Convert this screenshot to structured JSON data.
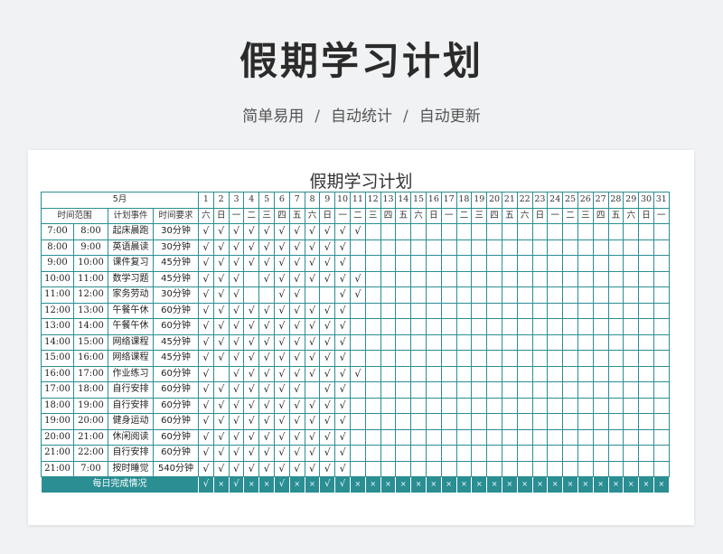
{
  "page": {
    "title": "假期学习计划",
    "subtitle_parts": [
      "简单易用",
      "自动统计",
      "自动更新"
    ],
    "separator": "/"
  },
  "sheet": {
    "title": "假期学习计划",
    "month_label": "5月",
    "header_labels": [
      "时间范围",
      "计划事件",
      "时间要求"
    ],
    "days": [
      1,
      2,
      3,
      4,
      5,
      6,
      7,
      8,
      9,
      10,
      11,
      12,
      13,
      14,
      15,
      16,
      17,
      18,
      19,
      20,
      21,
      22,
      23,
      24,
      25,
      26,
      27,
      28,
      29,
      30,
      31
    ],
    "weekdays": [
      "六",
      "日",
      "一",
      "二",
      "三",
      "四",
      "五",
      "六",
      "日",
      "一",
      "二",
      "三",
      "四",
      "五",
      "六",
      "日",
      "一",
      "二",
      "三",
      "四",
      "五",
      "六",
      "日",
      "一",
      "二",
      "三",
      "四",
      "五",
      "六",
      "日",
      "一"
    ],
    "rows": [
      {
        "start": "7:00",
        "end": "8:00",
        "task": "起床晨跑",
        "req": "30分钟",
        "marks": "√√√√√√√√√√√"
      },
      {
        "start": "8:00",
        "end": "9:00",
        "task": "英语晨读",
        "req": "30分钟",
        "marks": "√√√√√√√√√√"
      },
      {
        "start": "9:00",
        "end": "10:00",
        "task": "课件复习",
        "req": "45分钟",
        "marks": "√√√√√√√√√√"
      },
      {
        "start": "10:00",
        "end": "11:00",
        "task": "数学习题",
        "req": "45分钟",
        "marks": "√√√ √√√√√√√"
      },
      {
        "start": "11:00",
        "end": "12:00",
        "task": "家务劳动",
        "req": "30分钟",
        "marks": "√√√  √√  √√"
      },
      {
        "start": "12:00",
        "end": "13:00",
        "task": "午餐午休",
        "req": "60分钟",
        "marks": "√√√√√√√√√√"
      },
      {
        "start": "13:00",
        "end": "14:00",
        "task": "午餐午休",
        "req": "60分钟",
        "marks": "√√√√√√√√√√"
      },
      {
        "start": "14:00",
        "end": "15:00",
        "task": "网络课程",
        "req": "45分钟",
        "marks": "√√√√√√√√√√"
      },
      {
        "start": "15:00",
        "end": "16:00",
        "task": "网络课程",
        "req": "45分钟",
        "marks": "√√√√√√√√√√"
      },
      {
        "start": "16:00",
        "end": "17:00",
        "task": "作业练习",
        "req": "60分钟",
        "marks": "√ √√√√√√√√√"
      },
      {
        "start": "17:00",
        "end": "18:00",
        "task": "自行安排",
        "req": "60分钟",
        "marks": "√√√√√√√ √√"
      },
      {
        "start": "18:00",
        "end": "19:00",
        "task": "自行安排",
        "req": "60分钟",
        "marks": "√√√√√√√√√√"
      },
      {
        "start": "19:00",
        "end": "20:00",
        "task": "健身运动",
        "req": "60分钟",
        "marks": "√√√√√√√√√√"
      },
      {
        "start": "20:00",
        "end": "21:00",
        "task": "休闲阅读",
        "req": "60分钟",
        "marks": "√√√√√√√√√√"
      },
      {
        "start": "21:00",
        "end": "22:00",
        "task": "自行安排",
        "req": "60分钟",
        "marks": "√√√√√√√√√√"
      },
      {
        "start": "21:00",
        "end": "7:00",
        "task": "按时睡觉",
        "req": "540分钟",
        "marks": "√√√√√√√√√√"
      }
    ],
    "footer_label": "每日完成情况",
    "footer_marks": [
      "√",
      "×",
      "√",
      "×",
      "×",
      "√",
      "×",
      "×",
      "√",
      "√",
      "×",
      "×",
      "×",
      "×",
      "×",
      "×",
      "×",
      "×",
      "×",
      "×",
      "×",
      "×",
      "×",
      "×",
      "×",
      "×",
      "×",
      "×",
      "×",
      "×",
      "×"
    ],
    "colors": {
      "accent": "#2a8e93",
      "background": "#f1f2f4",
      "sheet": "#ffffff"
    }
  }
}
